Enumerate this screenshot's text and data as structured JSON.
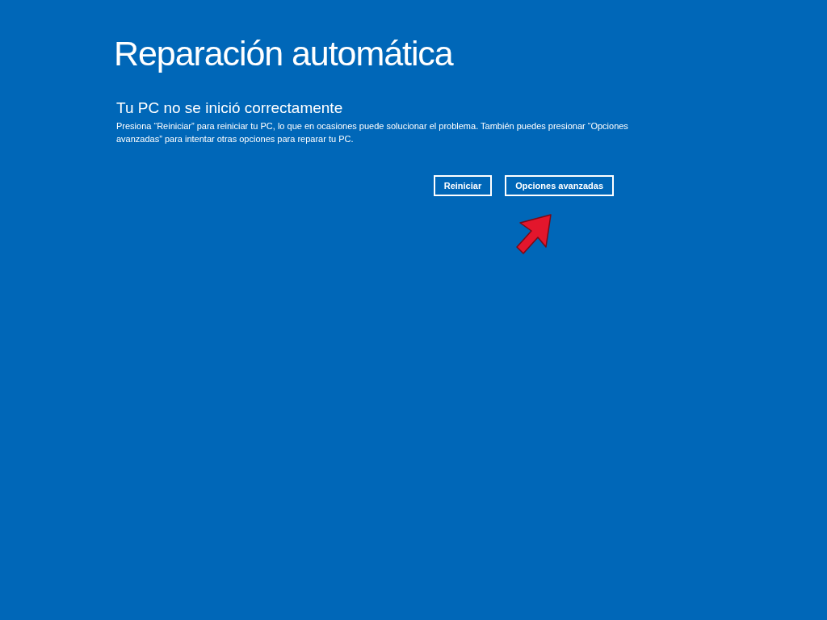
{
  "title": "Reparación automática",
  "subtitle": "Tu PC no se inició correctamente",
  "message": "Presiona “Reiniciar” para reiniciar tu PC, lo que en ocasiones puede solucionar el problema. También puedes presionar “Opciones avanzadas” para intentar otras opciones para reparar tu PC.",
  "buttons": [
    "Reiniciar",
    "Opciones avanzadas"
  ]
}
